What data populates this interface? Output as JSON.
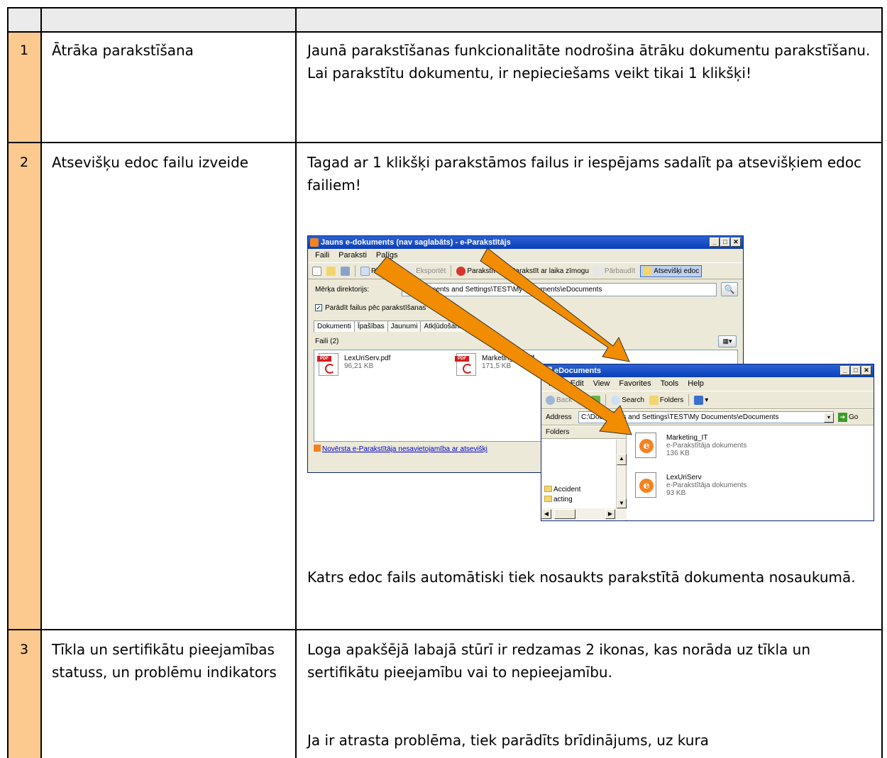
{
  "rows": [
    {
      "num": "1",
      "feature": "Ātrāka parakstīšana",
      "description": "Jaunā parakstīšanas funkcionalitāte nodrošina ātrāku dokumentu parakstīšanu. Lai parakstītu dokumentu, ir nepieciešams veikt tikai 1 klikšķi!"
    },
    {
      "num": "2",
      "feature": "Atsevišķu edoc failu izveide",
      "description": "Tagad ar 1 klikšķi parakstāmos failus ir iespējams sadalīt pa atsevišķiem edoc failiem!",
      "description_after": "Katrs edoc fails automātiski tiek nosaukts parakstītā dokumenta nosaukumā."
    },
    {
      "num": "3",
      "feature": "Tīkla un sertifikātu pieejamības statuss, un problēmu indikators",
      "description": "Loga apakšējā labajā stūrī ir redzamas 2 ikonas, kas norāda uz tīkla un sertifikātu pieejamību vai to nepieejamību.",
      "description_after": "Ja ir atrasta problēma, tiek parādīts brīdinājums, uz kura"
    }
  ],
  "screenshot": {
    "app_window": {
      "title": "Jauns e-dokuments (nav saglabāts) - e-Parakstītājs",
      "menu": [
        "Faili",
        "Paraksti",
        "Palīgs"
      ],
      "toolbar": {
        "add": "Pievienot",
        "export": "Eksportēt",
        "sign": "Parakstīt",
        "sign_timestamp": "Parakstīt ar laika zīmogu",
        "verify": "Pārbaudīt",
        "separate": "Atsevišķi edoc"
      },
      "target_dir_label": "Mērķa direktorijs:",
      "target_dir_value": "C:\\Documents and Settings\\TEST\\My Documents\\eDocuments",
      "show_files_label": "Parādīt failus pēc parakstīšanas",
      "tabs": [
        "Dokumenti",
        "Īpašības",
        "Jaunumi",
        "Atkļūdošana"
      ],
      "files_header": "Faili (2)",
      "files": [
        {
          "name": "LexUriServ.pdf",
          "size": "96,21 KB"
        },
        {
          "name": "Marketing_IT.pdf",
          "size": "171,5 KB"
        }
      ],
      "status_link": "Novērsta e-Parakstītāja nesavietojamība ar atsevišķi"
    },
    "explorer_window": {
      "title": "eDocuments",
      "menu": [
        "File",
        "Edit",
        "View",
        "Favorites",
        "Tools",
        "Help"
      ],
      "back": "Back",
      "search": "Search",
      "folders": "Folders",
      "address_label": "Address",
      "address_value": "C:\\Documents and Settings\\TEST\\My Documents\\eDocuments",
      "go": "Go",
      "folders_pane_label": "Folders",
      "folder_items": [
        "Accident",
        "acting"
      ],
      "items": [
        {
          "name": "Marketing_IT",
          "type": "e-Parakstītāja dokuments",
          "size": "136 KB"
        },
        {
          "name": "LexUriServ",
          "type": "e-Parakstītāja dokuments",
          "size": "93 KB"
        }
      ]
    },
    "arrow_color": "#f28c00"
  }
}
